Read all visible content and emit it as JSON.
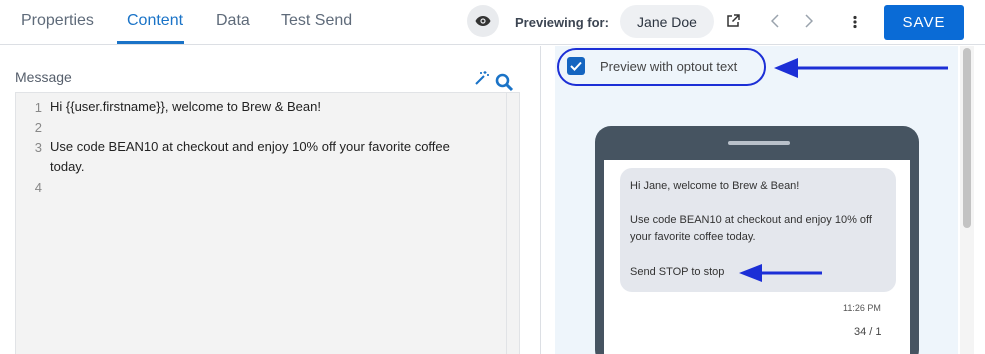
{
  "tabs": [
    {
      "label": "Properties"
    },
    {
      "label": "Content"
    },
    {
      "label": "Data"
    },
    {
      "label": "Test Send"
    }
  ],
  "header": {
    "previewing_label": "Previewing for:",
    "preview_user": "Jane Doe",
    "save_label": "SAVE"
  },
  "editor": {
    "label": "Message",
    "line_numbers": [
      "1",
      "2",
      "3",
      "4"
    ],
    "line1": "Hi {{user.firstname}}, welcome to Brew & Bean!",
    "line3": "Use code BEAN10 at checkout and enjoy 10% off your favorite coffee today."
  },
  "preview": {
    "optout_checkbox_label": "Preview with optout text",
    "optout_checked": true,
    "sms_line1": "Hi Jane, welcome to Brew & Bean!",
    "sms_line2": "Use code BEAN10 at checkout and enjoy 10% off your favorite coffee today.",
    "sms_optout": "Send STOP to stop",
    "timestamp": "11:26 PM",
    "char_count": "34 / 1"
  },
  "icons": [
    "eye-icon",
    "external-link-icon",
    "chevron-left-icon",
    "chevron-right-icon",
    "more-vertical-icon",
    "magic-wand-icon",
    "search-icon",
    "check-icon",
    "arrow-left-icon"
  ],
  "colors": {
    "accent": "#1a73c7",
    "save": "#0a6bd6",
    "annotation": "#1c2fd6"
  }
}
